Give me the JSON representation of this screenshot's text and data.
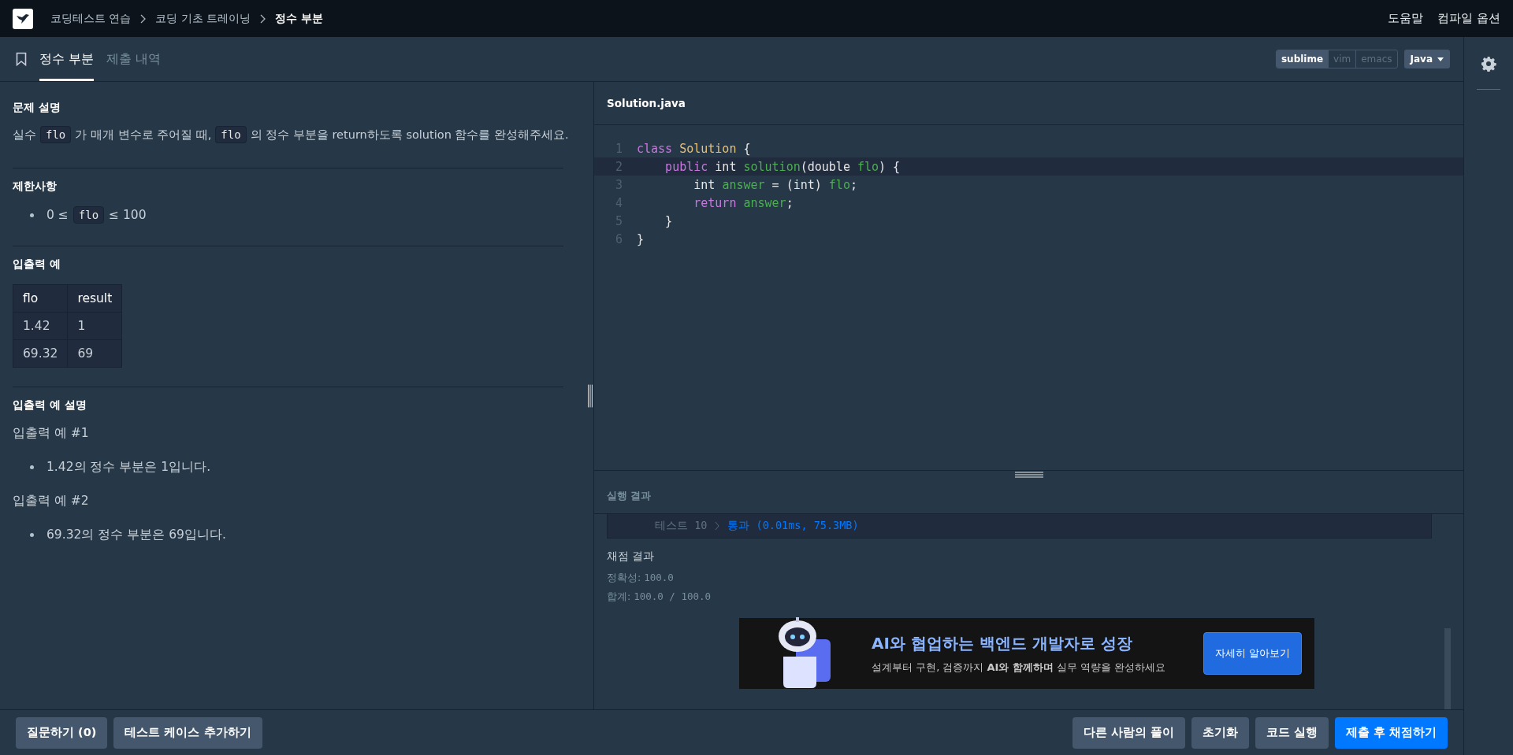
{
  "breadcrumb": [
    {
      "label": "코딩테스트 연습",
      "current": false
    },
    {
      "label": "코딩 기초 트레이닝",
      "current": false
    },
    {
      "label": "정수 부분",
      "current": true
    }
  ],
  "top_links": [
    "도움말",
    "컴파일 옵션"
  ],
  "tabs": [
    {
      "label": "정수 부분",
      "selected": true
    },
    {
      "label": "제출 내역",
      "selected": false
    }
  ],
  "editor_modes": [
    {
      "label": "sublime",
      "selected": true
    },
    {
      "label": "vim",
      "selected": false
    },
    {
      "label": "emacs",
      "selected": false
    }
  ],
  "language": "Java",
  "problem": {
    "sections": [
      {
        "kind": "text",
        "title": "문제 설명",
        "parts": [
          {
            "kind": "text",
            "text": "실수"
          },
          {
            "kind": "code",
            "text": "flo"
          },
          {
            "kind": "text",
            "text": "가 매개 변수로 주어질 때,"
          },
          {
            "kind": "code",
            "text": "flo"
          },
          {
            "kind": "text",
            "text": "의 정수 부분을 return하도록 solution 함수를 완성해주세요."
          }
        ]
      },
      {
        "kind": "list",
        "title": "제한사항",
        "parts": [
          {
            "kind": "text",
            "text": "0 ≤"
          },
          {
            "kind": "code",
            "text": "flo"
          },
          {
            "kind": "text",
            "text": "≤ 100"
          }
        ]
      },
      {
        "kind": "table",
        "title": "입출력 예",
        "columns": [
          "flo",
          "result"
        ],
        "rows": [
          [
            "1.42",
            "1"
          ],
          [
            "69.32",
            "69"
          ]
        ]
      },
      {
        "kind": "examples",
        "title": "입출력 예 설명",
        "examples": [
          {
            "heading": "입출력 예 #1",
            "bullet": "1.42의 정수 부분은 1입니다."
          },
          {
            "heading": "입출력 예 #2",
            "bullet": "69.32의 정수 부분은 69입니다."
          }
        ]
      }
    ]
  },
  "editor": {
    "filename": "Solution.java",
    "lines": [
      {
        "number": "1",
        "selected": false,
        "tokens": [
          {
            "kind": "keyword",
            "text": "class"
          },
          {
            "kind": "class",
            "text": "Solution"
          },
          {
            "kind": "plain",
            "text": "{"
          }
        ]
      },
      {
        "number": "2",
        "selected": true,
        "tokens": [
          {
            "kind": "keyword",
            "text": "    public"
          },
          {
            "kind": "plain",
            "text": "int"
          },
          {
            "kind": "var",
            "text": "solution"
          },
          {
            "kind": "glue",
            "text": "(double"
          },
          {
            "kind": "var",
            "text": "flo"
          },
          {
            "kind": "glue",
            "text": ") {"
          }
        ]
      },
      {
        "number": "3",
        "selected": false,
        "tokens": [
          {
            "kind": "plain",
            "text": "        int"
          },
          {
            "kind": "var",
            "text": "answer"
          },
          {
            "kind": "plain",
            "text": "= (int)"
          },
          {
            "kind": "var",
            "text": "flo"
          },
          {
            "kind": "glue",
            "text": ";"
          }
        ]
      },
      {
        "number": "4",
        "selected": false,
        "tokens": [
          {
            "kind": "keyword",
            "text": "        return"
          },
          {
            "kind": "var",
            "text": "answer"
          },
          {
            "kind": "glue",
            "text": ";"
          }
        ]
      },
      {
        "number": "5",
        "selected": false,
        "tokens": [
          {
            "kind": "plain",
            "text": "    }"
          }
        ]
      },
      {
        "number": "6",
        "selected": false,
        "tokens": [
          {
            "kind": "plain",
            "text": "}"
          }
        ]
      }
    ]
  },
  "results": {
    "title": "실행 결과",
    "tests": [
      {
        "name": "테스트 10",
        "result": "통과 (0.01ms, 75.3MB)"
      }
    ],
    "grading_title": "채점 결과",
    "grading": [
      {
        "label": "정확성:",
        "value": "100.0"
      },
      {
        "label": "합계:",
        "value": "100.0 / 100.0"
      }
    ]
  },
  "ad": {
    "title": "AI와 협업하는 백엔드 개발자로 성장",
    "subtitle": "설계부터 구현, 검증까지 **AI와 함께하며** 실무 역량을 완성하세요",
    "button": "자세히 알아보기"
  },
  "footer_left": [
    "질문하기 (0)",
    "테스트 케이스 추가하기"
  ],
  "footer_right": [
    {
      "label": "다른 사람의 풀이",
      "primary": false
    },
    {
      "label": "초기화",
      "primary": false
    },
    {
      "label": "코드 실행",
      "primary": false
    },
    {
      "label": "제출 후 채점하기",
      "primary": true
    }
  ]
}
